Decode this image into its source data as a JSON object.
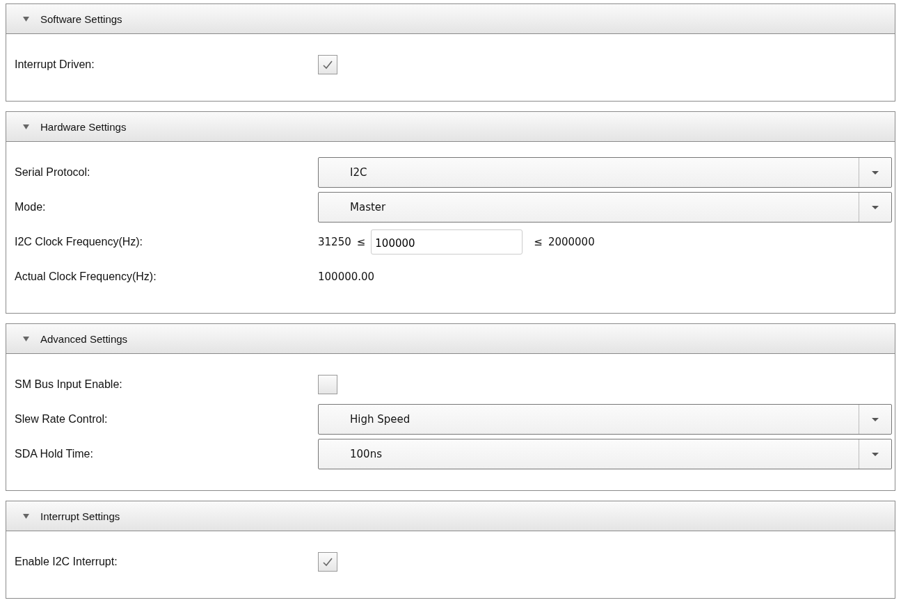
{
  "sections": [
    {
      "title": "Software Settings",
      "expanded": true,
      "rows": [
        {
          "kind": "checkbox",
          "label": "Interrupt Driven:",
          "checked": true
        }
      ]
    },
    {
      "title": "Hardware Settings",
      "expanded": true,
      "rows": [
        {
          "kind": "select",
          "label": "Serial Protocol:",
          "value": "I2C"
        },
        {
          "kind": "select",
          "label": "Mode:",
          "value": "Master"
        },
        {
          "kind": "range",
          "label": "I2C Clock Frequency(Hz):",
          "min": "31250",
          "min_sign": "≤",
          "value": "100000",
          "max_sign": "≤",
          "max": "2000000"
        },
        {
          "kind": "readout",
          "label": "Actual Clock Frequency(Hz):",
          "value": "100000.00"
        }
      ]
    },
    {
      "title": "Advanced Settings",
      "expanded": true,
      "rows": [
        {
          "kind": "checkbox",
          "label": "SM Bus Input Enable:",
          "checked": false
        },
        {
          "kind": "select",
          "label": "Slew Rate Control:",
          "value": "High Speed"
        },
        {
          "kind": "select",
          "label": "SDA Hold Time:",
          "value": "100ns"
        }
      ]
    },
    {
      "title": "Interrupt Settings",
      "expanded": true,
      "rows": [
        {
          "kind": "checkbox",
          "label": "Enable I2C Interrupt:",
          "checked": true
        }
      ]
    }
  ]
}
